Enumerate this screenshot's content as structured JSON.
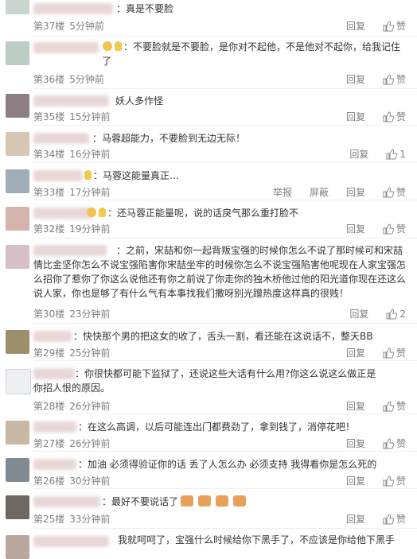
{
  "actions": {
    "reply": "回复",
    "like": "赞",
    "report": "举报",
    "block": "屏蔽"
  },
  "comments": [
    {
      "text": "：真是不要脸",
      "floor": "第37楼",
      "time": "5分钟前",
      "likes": ""
    },
    {
      "text": "：不要脸就是不要脸，是你对不起他，不是他对不起你，给我记住了",
      "floor": "第36楼",
      "time": "5分钟前",
      "likes": ""
    },
    {
      "text": "妖人多作怪",
      "floor": "第35楼",
      "time": "15分钟前",
      "likes": ""
    },
    {
      "text": "：马蓉超能力，不要脸到无边无际！",
      "floor": "第34楼",
      "time": "16分钟前",
      "likes": "1"
    },
    {
      "text": "：马蓉这能量真正…",
      "floor": "第33楼",
      "time": "17分钟前",
      "likes": ""
    },
    {
      "text": "：还马蓉正能量呢，说的话戾气那么重打脸不",
      "floor": "第32楼",
      "time": "19分钟前",
      "likes": ""
    },
    {
      "text": "：之前，宋喆和你一起背叛宝强的时候你怎么不说了那时候可和宋喆情比金坚你怎么不说宝强陷害你宋喆坐牢的时候你怎么不说宝强陷害他呢现在人家宝强怎么招你了惹你了你这么说他还有你之前说了你走你的独木桥他过他的阳光道你现在还这么说人家，你也是够了有什么气有本事找我们撒呀别光蹭热度这样真的很贱！",
      "floor": "第30楼",
      "time": "23分钟前",
      "likes": "2"
    },
    {
      "text": "：快快那个男的把这女的收了，舌头一割，看还能在这说话不，整天BB",
      "floor": "第29楼",
      "time": "25分钟前",
      "likes": ""
    },
    {
      "text": "：你很快都可能下监狱了，还说这些大话有什么用?你这么说这么做正是你招人恨的原因。",
      "floor": "第28楼",
      "time": "26分钟前",
      "likes": ""
    },
    {
      "text": "：在这么高调，以后可能连出门都费劲了，拿到钱了，消停花吧！",
      "floor": "第27楼",
      "time": "26分钟前",
      "likes": ""
    },
    {
      "text": "：加油 必须得验证你的话  丢了人怎么办  必须支持  我得看你是怎么死的",
      "floor": "第26楼",
      "time": "30分钟前",
      "likes": ""
    },
    {
      "text": "：最好不要说话了",
      "floor": "第25楼",
      "time": "33分钟前",
      "likes": ""
    },
    {
      "text": "我就呵呵了，宝强什么时候给你下黑手了，不应该是你给他下黑手",
      "floor": "",
      "time": "",
      "likes": ""
    }
  ]
}
